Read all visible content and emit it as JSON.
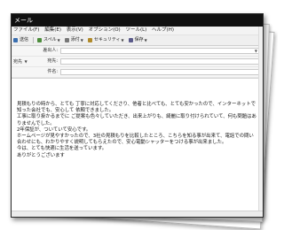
{
  "window": {
    "title": "メール"
  },
  "menu": [
    {
      "label": "ファイル(F)"
    },
    {
      "label": "編集(E)"
    },
    {
      "label": "表示(V)"
    },
    {
      "label": "オプション(O)"
    },
    {
      "label": "ツール(L)"
    },
    {
      "label": "ヘルプ(H)"
    }
  ],
  "toolbar": {
    "send": "送信",
    "spell": "スペル",
    "attach": "添付",
    "security": "セキュリティ",
    "save": "保存"
  },
  "headers": {
    "from_label": "差出人:",
    "to_label": "宛先:",
    "subject_label": "件名:",
    "to_selector": "宛先"
  },
  "body_lines": [
    "見積もりの時から、とても 丁寧に対応してくださり、他者と比べても、とても安かったので、インターネットで知った会社でも、安心して 依頼できました。",
    "工事に取り掛かるまでに ご提案も色々していただき、出来上がりも、綺麗に取り付けられていて、何も問題はありませんでした。",
    "2年保証が、ついていて安心です。",
    "ホームページが見やすかったので、3社の見積もりを比較したところ、こちらを知る事が出来て、電話での問い合わせにも、わかりやすく説明してもらえたので、安心電動シャッターをつける事が出来ました。",
    "今は、とても快適に生活を送っています。",
    "ありがとうございます"
  ]
}
